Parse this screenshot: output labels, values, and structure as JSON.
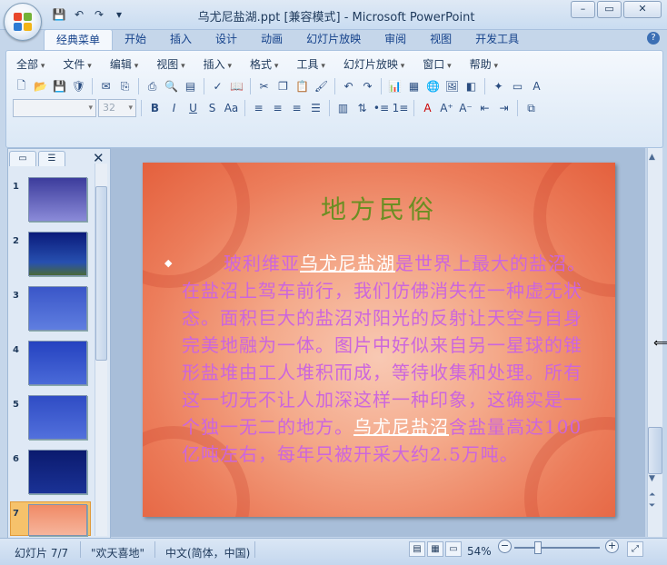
{
  "window": {
    "title": "乌尤尼盐湖.ppt [兼容模式] - Microsoft PowerPoint",
    "controls": [
      "–",
      "▭",
      "✕"
    ]
  },
  "quick_access": [
    "save-icon",
    "undo-icon",
    "redo-icon",
    "customize-icon"
  ],
  "ribbon_tabs": [
    "经典菜单",
    "开始",
    "插入",
    "设计",
    "动画",
    "幻灯片放映",
    "审阅",
    "视图",
    "开发工具"
  ],
  "active_tab": "经典菜单",
  "menus": [
    "全部",
    "文件",
    "编辑",
    "视图",
    "插入",
    "格式",
    "工具",
    "幻灯片放映",
    "窗口",
    "帮助"
  ],
  "font_name_value": "",
  "font_size_value": "32",
  "slide_pane": {
    "slides": [
      {
        "num": "1"
      },
      {
        "num": "2"
      },
      {
        "num": "3"
      },
      {
        "num": "4"
      },
      {
        "num": "5"
      },
      {
        "num": "6"
      },
      {
        "num": "7"
      }
    ],
    "selected": "7"
  },
  "slide": {
    "title": "地方民俗",
    "body_pre": "玻利维亚",
    "link1": "乌尤尼盐湖",
    "body_mid": "是世界上最大的盐沼。在盐沼上驾车前行，我们仿佛消失在一种虚无状态。面积巨大的盐沼对阳光的反射让天空与自身完美地融为一体。图片中好似来自另一星球的锥形盐堆由工人堆积而成，等待收集和处理。所有这一切无不让人加深这样一种印象，这确实是一个独一无二的地方。",
    "link2": "乌尤尼盐沼",
    "body_post": "含盐量高达100亿吨左右，每年只被开采大约2.5万吨。"
  },
  "status": {
    "slide_info": "幻灯片 7/7",
    "theme": "\"欢天喜地\"",
    "language": "中文(简体，中国)",
    "zoom": "54%"
  },
  "colors": {
    "title_text": "#6b8e23",
    "body_text": "#cc66dd",
    "slide_bg": "#ec7d5b"
  }
}
